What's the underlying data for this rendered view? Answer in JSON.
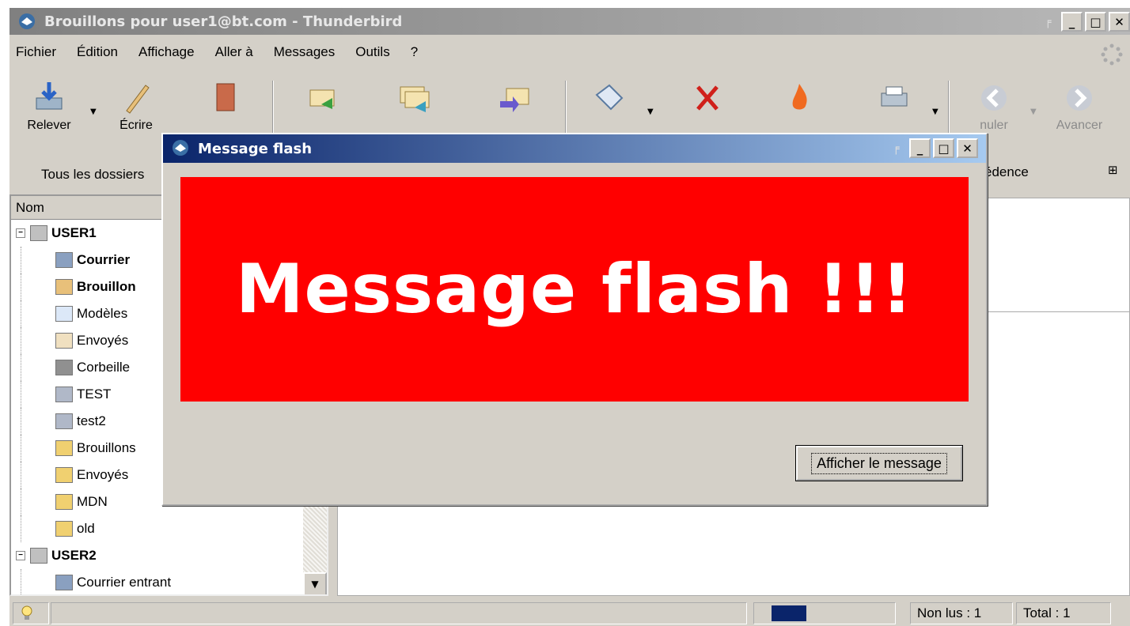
{
  "window": {
    "title": "Brouillons pour user1@bt.com - Thunderbird"
  },
  "menu": [
    "Fichier",
    "Édition",
    "Affichage",
    "Aller à",
    "Messages",
    "Outils",
    "?"
  ],
  "toolbar": {
    "releve": "Relever",
    "ecrire": "Écrire",
    "annuler": "nuler",
    "avancer": "Avancer"
  },
  "folder_bar": {
    "label": "Tous les dossiers"
  },
  "folder_pane": {
    "header": "Nom",
    "items": [
      {
        "label": "USER1",
        "icon": "account-icon",
        "bold": true
      },
      {
        "label": "Courrier",
        "icon": "inbox-icon",
        "bold": true
      },
      {
        "label": "Brouillon",
        "icon": "drafts-icon",
        "bold": true
      },
      {
        "label": "Modèles",
        "icon": "templates-icon",
        "bold": false
      },
      {
        "label": "Envoyés",
        "icon": "sent-icon",
        "bold": false
      },
      {
        "label": "Corbeille",
        "icon": "trash-icon",
        "bold": false
      },
      {
        "label": "TEST",
        "icon": "search-folder-icon",
        "bold": false
      },
      {
        "label": "test2",
        "icon": "search-folder-icon",
        "bold": false
      },
      {
        "label": "Brouillons",
        "icon": "folder-icon",
        "bold": false
      },
      {
        "label": "Envoyés",
        "icon": "folder-icon",
        "bold": false
      },
      {
        "label": "MDN",
        "icon": "folder-icon",
        "bold": false
      },
      {
        "label": "old",
        "icon": "folder-icon",
        "bold": false
      },
      {
        "label": "USER2",
        "icon": "account-icon",
        "bold": true
      },
      {
        "label": "Courrier entrant",
        "icon": "inbox-icon",
        "bold": false
      }
    ]
  },
  "message_list": {
    "column_fragment": "édence"
  },
  "status": {
    "progress": 0.25,
    "unread": "Non lus : 1",
    "total": "Total : 1"
  },
  "dialog": {
    "title": "Message flash",
    "message": "Message flash !!!",
    "button": "Afficher le message",
    "colors": {
      "banner": "#ff0000",
      "text": "#ffffff"
    }
  }
}
